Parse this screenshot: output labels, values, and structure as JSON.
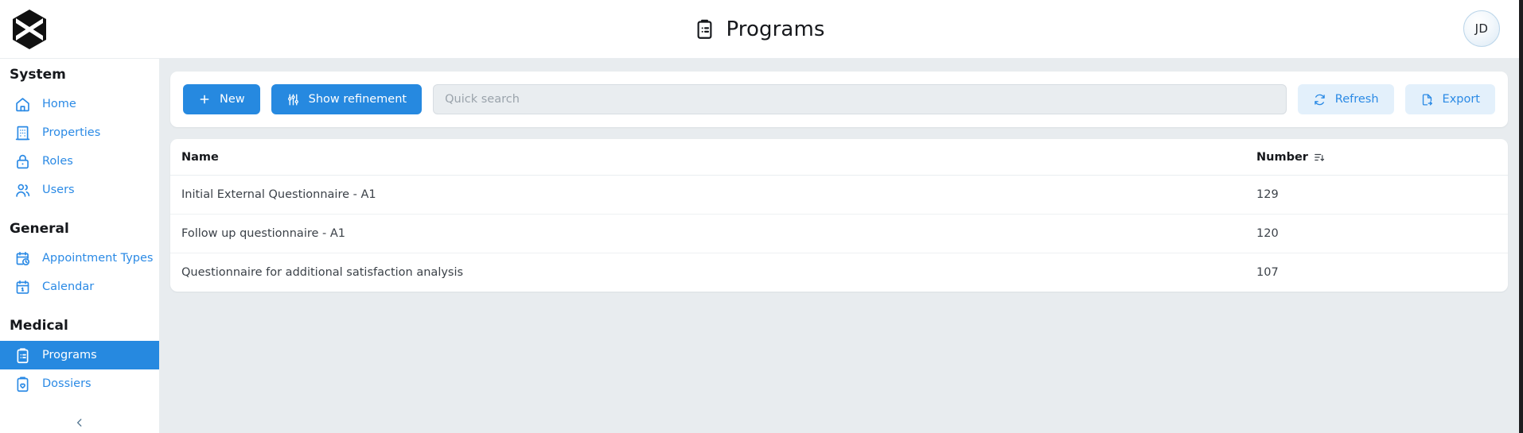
{
  "header": {
    "title": "Programs",
    "title_icon": "clipboard-list-icon",
    "logo_icon": "hexagon-x-logo",
    "avatar_initials": "JD"
  },
  "sidebar": {
    "groups": [
      {
        "title": "System",
        "items": [
          {
            "label": "Home",
            "icon": "home-icon",
            "active": false
          },
          {
            "label": "Properties",
            "icon": "building-icon",
            "active": false
          },
          {
            "label": "Roles",
            "icon": "lock-icon",
            "active": false
          },
          {
            "label": "Users",
            "icon": "users-icon",
            "active": false
          }
        ]
      },
      {
        "title": "General",
        "items": [
          {
            "label": "Appointment Types",
            "icon": "calendar-clock-icon",
            "active": false
          },
          {
            "label": "Calendar",
            "icon": "calendar-icon",
            "active": false
          }
        ]
      },
      {
        "title": "Medical",
        "items": [
          {
            "label": "Programs",
            "icon": "clipboard-list-icon",
            "active": true
          },
          {
            "label": "Dossiers",
            "icon": "clipboard-heart-icon",
            "active": false
          }
        ]
      }
    ],
    "collapse_icon": "chevron-left-icon"
  },
  "toolbar": {
    "new_label": "New",
    "new_icon": "plus-icon",
    "refinement_label": "Show refinement",
    "refinement_icon": "sliders-icon",
    "search_placeholder": "Quick search",
    "search_value": "",
    "refresh_label": "Refresh",
    "refresh_icon": "refresh-icon",
    "export_label": "Export",
    "export_icon": "file-export-icon"
  },
  "table": {
    "columns": [
      {
        "label": "Name",
        "sorted": false
      },
      {
        "label": "Number",
        "sorted": true,
        "sort_icon": "sort-descending-icon"
      }
    ],
    "rows": [
      {
        "name": "Initial External Questionnaire - A1",
        "number": "129"
      },
      {
        "name": "Follow up questionnaire - A1",
        "number": "120"
      },
      {
        "name": "Questionnaire for additional satisfaction analysis",
        "number": "107"
      }
    ]
  },
  "colors": {
    "primary": "#2689e0",
    "link": "#2b8ae5",
    "soft_blue_bg": "#e3f0fb",
    "content_bg": "#e8ecef",
    "text": "#16181c"
  }
}
